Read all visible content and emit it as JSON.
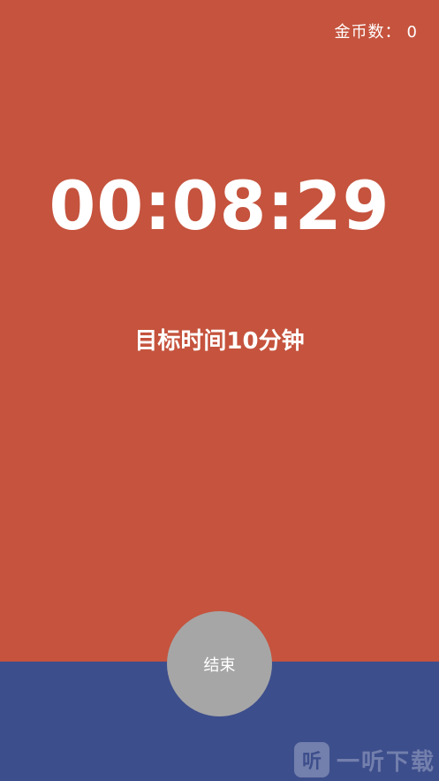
{
  "header": {
    "coins_label": "金币数：",
    "coins_value": "0"
  },
  "timer": {
    "elapsed": "00:08:29"
  },
  "target": {
    "text": "目标时间10分钟"
  },
  "actions": {
    "end_label": "结束"
  },
  "watermark": {
    "logo_glyph": "听",
    "text": "一听下载"
  },
  "colors": {
    "background_top": "#c5533d",
    "background_bottom": "#3d4e8c",
    "button": "#a6a6a6",
    "text": "#ffffff"
  }
}
